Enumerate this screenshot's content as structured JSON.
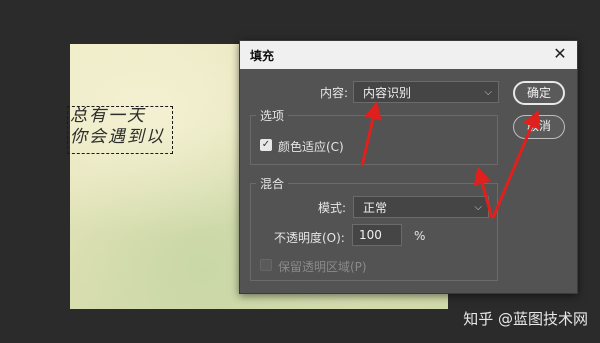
{
  "canvas": {
    "text": "总有一天\n你会遇到以"
  },
  "dialog": {
    "title": "填充",
    "content_label": "内容:",
    "content_value": "内容识别",
    "options_title": "选项",
    "color_adapt_label": "颜色适应(C)",
    "color_adapt_checked": true,
    "blend_title": "混合",
    "mode_label": "模式:",
    "mode_value": "正常",
    "opacity_label": "不透明度(O):",
    "opacity_value": "100",
    "opacity_unit": "%",
    "preserve_label": "保留透明区域(P)",
    "ok_label": "确定",
    "cancel_label": "取消"
  },
  "watermark": "知乎 @蓝图技术网",
  "colors": {
    "annotation_red": "#e0201c",
    "dialog_bg": "#535353",
    "titlebar_bg": "#f0f0f0"
  },
  "icons": {
    "close": "close-icon",
    "chevron": "chevron-down-icon",
    "check": "check-icon"
  }
}
